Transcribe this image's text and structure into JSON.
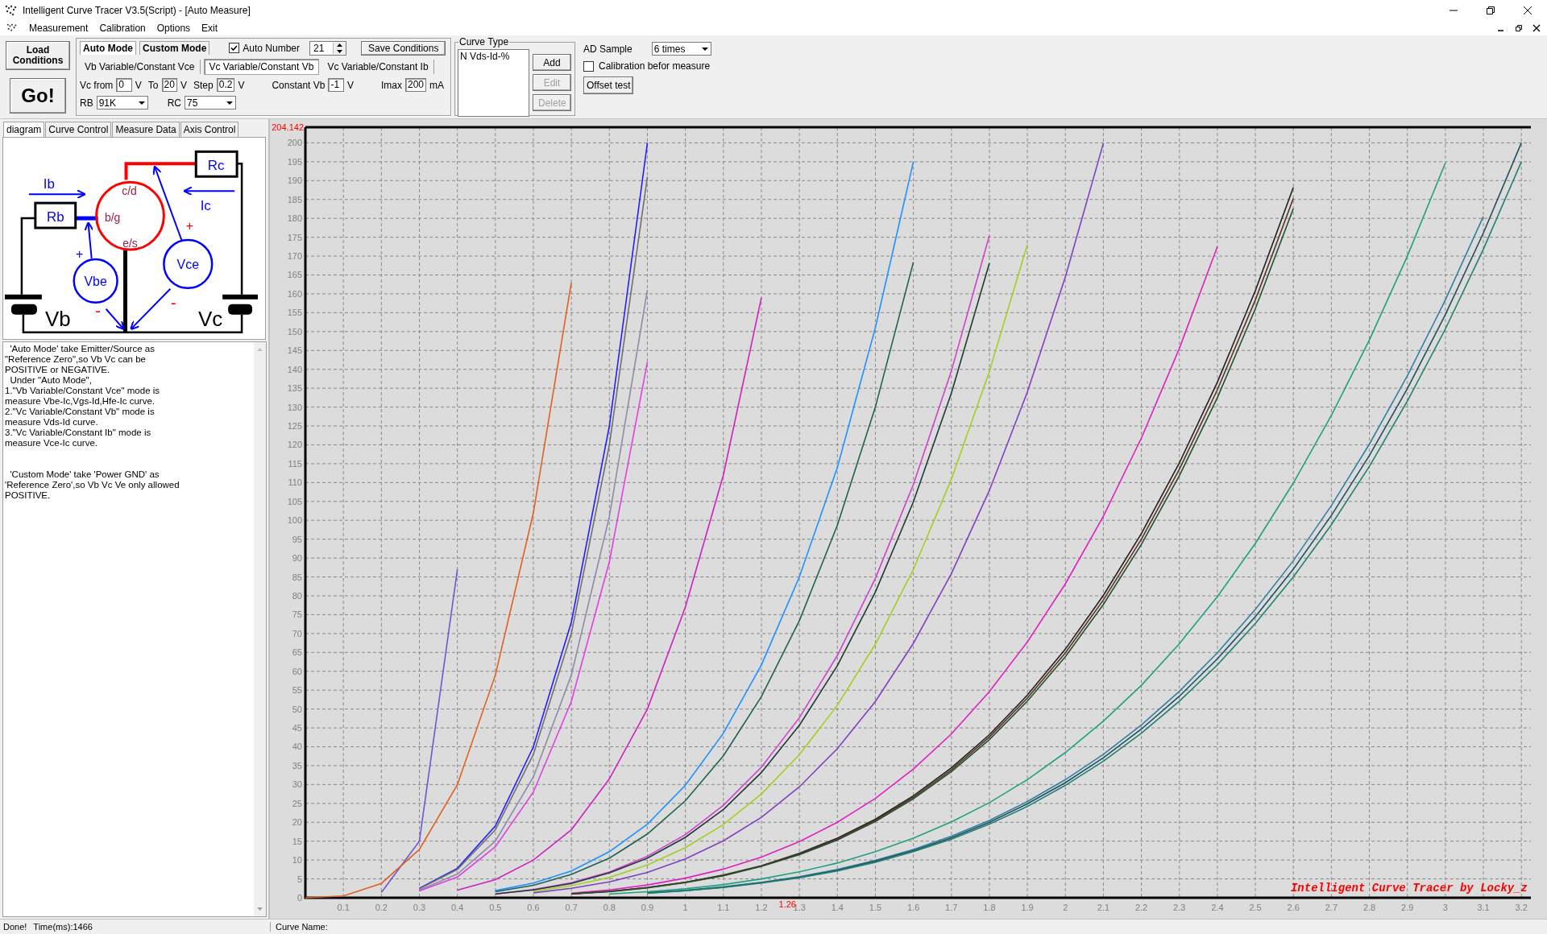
{
  "window": {
    "title": "Intelligent Curve Tracer V3.5(Script) - [Auto Measure]"
  },
  "menu": [
    "Measurement",
    "Calibration",
    "Options",
    "Exit"
  ],
  "toolbar": {
    "load_button": "Load Conditions",
    "go_button": "Go!",
    "mode_tabs": [
      {
        "label": "Auto Mode",
        "selected": true
      },
      {
        "label": "Custom Mode",
        "selected": false
      }
    ],
    "auto_number": {
      "label": "Auto Number",
      "checked": true,
      "value": "21"
    },
    "save_button": "Save Conditions",
    "sub_tabs": [
      {
        "label": "Vb Variable/Constant Vce",
        "selected": false
      },
      {
        "label": "Vc Variable/Constant Vb",
        "selected": true
      },
      {
        "label": "Vc Variable/Constant Ib",
        "selected": false
      }
    ],
    "fields": [
      {
        "label": "Vc from",
        "value": "0",
        "unit": "V"
      },
      {
        "label": "To",
        "value": "20",
        "unit": "V"
      },
      {
        "label": "Step",
        "value": "0.2",
        "unit": "V"
      },
      {
        "label": "Constant Vb",
        "value": "-1",
        "unit": "V"
      },
      {
        "label": "Imax",
        "value": "200",
        "unit": "mA"
      }
    ],
    "selects": [
      {
        "label": "RB",
        "value": "91K"
      },
      {
        "label": "RC",
        "value": "75"
      }
    ]
  },
  "curve_type": {
    "title": "Curve Type",
    "items": [
      "N Vds-Id-%"
    ],
    "buttons": [
      {
        "label": "Add",
        "disabled": false
      },
      {
        "label": "Edit",
        "disabled": true
      },
      {
        "label": "Delete",
        "disabled": true
      }
    ]
  },
  "ad_sample": {
    "label": "AD Sample",
    "value": "6 times"
  },
  "calibration": {
    "label": "Calibration befor measure",
    "checked": false
  },
  "offset_button": "Offset test",
  "left_tabs": [
    {
      "label": "diagram",
      "selected": true
    },
    {
      "label": "Curve Control",
      "selected": false
    },
    {
      "label": "Measure Data",
      "selected": false
    },
    {
      "label": "Axis Control",
      "selected": false
    }
  ],
  "diagram": {
    "rc": "Rc",
    "rb": "Rb",
    "ib": "Ib",
    "ic": "Ic",
    "collector": "c/d",
    "base": "b/g",
    "emitter": "e/s",
    "vbe": "Vbe",
    "vce": "Vce",
    "vb": "Vb",
    "vc": "Vc",
    "vbe_plus": "+",
    "vce_plus": "+",
    "vbe_minus": "-",
    "vce_minus": "-"
  },
  "help_text": [
    [
      "  'Auto Mode' take Emitter/Source as",
      "\"Reference Zero\",so Vb Vc can be",
      "POSITIVE or NEGATIVE.",
      "  Under \"Auto Mode\",",
      "1.\"Vb Variable/Constant Vce\" mode is",
      "measure Vbe-Ic,Vgs-Id,Hfe-Ic curve.",
      "2.\"Vc Variable/Constant Vb\" mode is",
      "measure Vds-Id curve.",
      "3.\"Vc Variable/Constant Ib\" mode is",
      "measure Vce-Ic curve."
    ],
    [
      "  'Custom Mode' take 'Power GND' as",
      "'Reference Zero',so Vb Vc Ve only allowed",
      "POSITIVE."
    ]
  ],
  "chart": {
    "y_max_label": "204.142",
    "cursor_x_label": "1.26",
    "caption": "Intelligent Curve Tracer by Locky_z",
    "chart_data": {
      "type": "line",
      "grid": true,
      "x": [
        0,
        0.1,
        0.2,
        0.3,
        0.4,
        0.5,
        0.6,
        0.7,
        0.8,
        0.9,
        1.0,
        1.1,
        1.2,
        1.3,
        1.4,
        1.5,
        1.6,
        1.7,
        1.8,
        1.9,
        2.0,
        2.1,
        2.2,
        2.3,
        2.4,
        2.5,
        2.6,
        2.7,
        2.8,
        2.9,
        3.0,
        3.1,
        3.2
      ],
      "series": [
        {
          "color": "#6a5acd",
          "values": [
            null,
            null,
            1.4,
            15,
            87,
            null,
            null,
            null,
            null,
            null,
            null,
            null,
            null,
            null,
            null,
            null,
            null,
            null,
            null,
            null,
            null,
            null,
            null,
            null,
            null,
            null,
            null,
            null,
            null,
            null,
            null,
            null,
            null
          ]
        },
        {
          "color": "#e06020",
          "values": [
            0,
            0.5,
            3.8,
            12.8,
            30,
            59,
            102,
            163,
            null,
            null,
            null,
            null,
            null,
            null,
            null,
            null,
            null,
            null,
            null,
            null,
            null,
            null,
            null,
            null,
            null,
            null,
            null,
            null,
            null,
            null,
            null,
            null,
            null
          ]
        },
        {
          "color": "#2020ff",
          "values": [
            null,
            null,
            null,
            2.5,
            7.8,
            19,
            40,
            73,
            125,
            200,
            null,
            null,
            null,
            null,
            null,
            null,
            null,
            null,
            null,
            null,
            null,
            null,
            null,
            null,
            null,
            null,
            null,
            null,
            null,
            null,
            null,
            null,
            null
          ]
        },
        {
          "color": "#707070",
          "values": [
            null,
            null,
            null,
            2.4,
            7.5,
            18,
            38,
            70,
            120,
            191,
            null,
            null,
            null,
            null,
            null,
            null,
            null,
            null,
            null,
            null,
            null,
            null,
            null,
            null,
            null,
            null,
            null,
            null,
            null,
            null,
            null,
            null,
            null
          ]
        },
        {
          "color": "#8c8ca8",
          "values": [
            null,
            null,
            null,
            2,
            6.3,
            15,
            32,
            59,
            101,
            161,
            null,
            null,
            null,
            null,
            null,
            null,
            null,
            null,
            null,
            null,
            null,
            null,
            null,
            null,
            null,
            null,
            null,
            null,
            null,
            null,
            null,
            null,
            null
          ]
        },
        {
          "color": "#e040e0",
          "values": [
            null,
            null,
            null,
            1.8,
            5.5,
            13.5,
            28,
            52,
            89,
            142,
            null,
            null,
            null,
            null,
            null,
            null,
            null,
            null,
            null,
            null,
            null,
            null,
            null,
            null,
            null,
            null,
            null,
            null,
            null,
            null,
            null,
            null,
            null
          ]
        },
        {
          "color": "#d020c0",
          "values": [
            null,
            null,
            null,
            null,
            2,
            4.8,
            10,
            18,
            31.5,
            50,
            77,
            112,
            159,
            null,
            null,
            null,
            null,
            null,
            null,
            null,
            null,
            null,
            null,
            null,
            null,
            null,
            null,
            null,
            null,
            null,
            null,
            null,
            null
          ]
        },
        {
          "color": "#1e90ff",
          "values": [
            null,
            null,
            null,
            null,
            null,
            1.9,
            3.9,
            7.1,
            12.2,
            19.5,
            29.8,
            43.6,
            61.7,
            85,
            114,
            151,
            195,
            null,
            null,
            null,
            null,
            null,
            null,
            null,
            null,
            null,
            null,
            null,
            null,
            null,
            null,
            null,
            null
          ]
        },
        {
          "color": "#206050",
          "values": [
            null,
            null,
            null,
            null,
            null,
            1.6,
            3.3,
            6.2,
            10.5,
            16.9,
            25.7,
            37.6,
            53.3,
            73.4,
            98.7,
            130,
            168.4,
            null,
            null,
            null,
            null,
            null,
            null,
            null,
            null,
            null,
            null,
            null,
            null,
            null,
            null,
            null,
            null
          ]
        },
        {
          "color": "#d040d0",
          "values": [
            null,
            null,
            null,
            null,
            null,
            1,
            2.2,
            4,
            6.8,
            11,
            16.7,
            24.5,
            34.6,
            47.7,
            64.2,
            84.6,
            109.5,
            139.6,
            175.4,
            null,
            null,
            null,
            null,
            null,
            null,
            null,
            null,
            null,
            null,
            null,
            null,
            null,
            null
          ]
        },
        {
          "color": "#203838",
          "values": [
            null,
            null,
            null,
            null,
            null,
            1,
            2.1,
            3.8,
            6.6,
            10.5,
            16,
            23.4,
            33.2,
            45.7,
            61.5,
            81,
            104.9,
            133.7,
            168.1,
            null,
            null,
            null,
            null,
            null,
            null,
            null,
            null,
            null,
            null,
            null,
            null,
            null,
            null
          ]
        },
        {
          "color": "#a0d020",
          "values": [
            null,
            null,
            null,
            null,
            null,
            null,
            1.7,
            3.2,
            5.4,
            8.7,
            13.3,
            19.4,
            27.5,
            37.9,
            51,
            67.2,
            87,
            110.9,
            139.4,
            173.1,
            null,
            null,
            null,
            null,
            null,
            null,
            null,
            null,
            null,
            null,
            null,
            null,
            null
          ]
        },
        {
          "color": "#8040c0",
          "values": [
            null,
            null,
            null,
            null,
            null,
            null,
            1.3,
            2.5,
            4.2,
            6.7,
            10.3,
            15.1,
            21.3,
            29.4,
            39.5,
            52,
            67.4,
            85.9,
            107.9,
            134,
            164.5,
            199.9,
            null,
            null,
            null,
            null,
            null,
            null,
            null,
            null,
            null,
            null,
            null
          ]
        },
        {
          "color": "#e020c0",
          "values": [
            null,
            null,
            null,
            null,
            null,
            null,
            null,
            1.2,
            2.1,
            3.4,
            5.2,
            7.6,
            10.8,
            14.9,
            20,
            26.3,
            34.1,
            43.4,
            54.6,
            67.8,
            83.2,
            101.1,
            121.8,
            145.5,
            172.5,
            null,
            null,
            null,
            null,
            null,
            null,
            null,
            null
          ]
        },
        {
          "color": "#202020",
          "values": [
            null,
            null,
            null,
            null,
            null,
            null,
            null,
            1,
            1.7,
            2.7,
            4.1,
            6,
            8.5,
            11.8,
            15.8,
            20.8,
            27,
            34.4,
            43.2,
            53.7,
            65.9,
            80.1,
            96.5,
            115.2,
            136.6,
            160.9,
            188.2,
            null,
            null,
            null,
            null,
            null,
            null
          ]
        },
        {
          "color": "#603020",
          "values": [
            null,
            null,
            null,
            null,
            null,
            null,
            null,
            1,
            1.7,
            2.7,
            4.1,
            5.9,
            8.4,
            11.6,
            15.6,
            20.5,
            26.6,
            33.9,
            42.6,
            52.9,
            64.9,
            78.9,
            95,
            113.5,
            134.6,
            158.4,
            185.3,
            null,
            null,
            null,
            null,
            null,
            null
          ]
        },
        {
          "color": "#205030",
          "values": [
            null,
            null,
            null,
            null,
            null,
            null,
            null,
            1,
            1.6,
            2.6,
            4,
            5.8,
            8.3,
            11.4,
            15.3,
            20.2,
            26.2,
            33.4,
            41.9,
            52.1,
            63.9,
            77.7,
            93.6,
            111.8,
            132.5,
            156.1,
            182.6,
            null,
            null,
            null,
            null,
            null,
            null
          ]
        },
        {
          "color": "#20a080",
          "values": [
            null,
            null,
            null,
            null,
            null,
            null,
            null,
            null,
            1,
            1.6,
            2.4,
            3.5,
            5,
            6.9,
            9.2,
            12.2,
            15.8,
            20.1,
            25.2,
            31.3,
            38.5,
            46.8,
            56.3,
            67.3,
            79.8,
            93.9,
            109.9,
            127.8,
            147.8,
            170,
            194.7,
            null,
            null
          ]
        },
        {
          "color": "#3080a0",
          "values": [
            null,
            null,
            null,
            null,
            null,
            null,
            null,
            null,
            null,
            1.3,
            2,
            2.9,
            4.1,
            5.6,
            7.5,
            9.9,
            12.8,
            16.3,
            20.5,
            25.5,
            31.3,
            38,
            45.8,
            54.7,
            64.9,
            76.4,
            89.3,
            103.9,
            120.2,
            138.3,
            158.4,
            180.5,
            null
          ]
        },
        {
          "color": "#205060",
          "values": [
            null,
            null,
            null,
            null,
            null,
            null,
            null,
            null,
            null,
            1.3,
            1.9,
            2.8,
            4,
            5.4,
            7.3,
            9.7,
            12.5,
            15.9,
            20,
            24.9,
            30.5,
            37.1,
            44.7,
            53.4,
            63.3,
            74.5,
            87.1,
            101.3,
            117.2,
            134.9,
            154.5,
            176.1,
            200
          ]
        },
        {
          "color": "#208070",
          "values": [
            null,
            null,
            null,
            null,
            null,
            null,
            null,
            null,
            null,
            1.2,
            1.9,
            2.7,
            3.9,
            5.3,
            7.1,
            9.4,
            12.2,
            15.5,
            19.5,
            24.2,
            29.8,
            36.2,
            43.6,
            52.1,
            61.7,
            72.7,
            85,
            98.8,
            114.3,
            131.6,
            150.7,
            171.8,
            195
          ]
        }
      ],
      "xlim": [
        0,
        3.225
      ],
      "ylim": [
        0,
        204.142
      ],
      "xticks": [
        0.1,
        0.2,
        0.3,
        0.4,
        0.5,
        0.6,
        0.7,
        0.8,
        0.9,
        1,
        1.1,
        1.2,
        1.3,
        1.4,
        1.5,
        1.6,
        1.7,
        1.8,
        1.9,
        2,
        2.1,
        2.2,
        2.3,
        2.4,
        2.5,
        2.6,
        2.7,
        2.8,
        2.9,
        3,
        3.1,
        3.2
      ],
      "yticks": [
        0,
        5,
        10,
        15,
        20,
        25,
        30,
        35,
        40,
        45,
        50,
        55,
        60,
        65,
        70,
        75,
        80,
        85,
        90,
        95,
        100,
        105,
        110,
        115,
        120,
        125,
        130,
        135,
        140,
        145,
        150,
        155,
        160,
        165,
        170,
        175,
        180,
        185,
        190,
        195,
        200
      ]
    }
  },
  "status_bar": {
    "message": "Done!",
    "time": "Time(ms):1466",
    "curve_name_label": "Curve Name:"
  }
}
